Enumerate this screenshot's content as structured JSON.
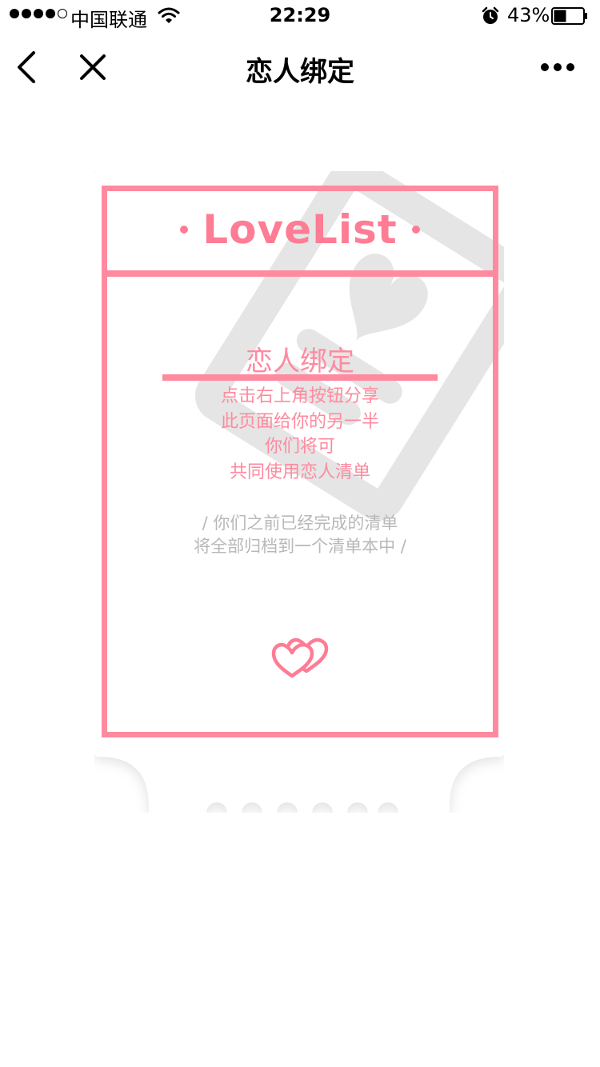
{
  "status_bar": {
    "carrier": "中国联通",
    "time": "22:29",
    "battery_percent": "43%",
    "battery_level": 0.43,
    "signal_bars_filled": 4,
    "signal_bars_total": 5
  },
  "nav": {
    "title": "恋人绑定"
  },
  "card": {
    "brand": "LoveList",
    "title": "恋人绑定",
    "description": [
      "点击右上角按钮分享",
      "此页面给你的另一半",
      "你们将可",
      "共同使用恋人清单"
    ],
    "note": [
      "/ 你们之前已经完成的清单",
      "将全部归档到一个清单本中 /"
    ]
  },
  "colors": {
    "accent_pink": "#fe8a9f",
    "note_gray": "#b8b8b8",
    "watermark_gray": "#e6e6e6"
  },
  "icons": [
    "back-arrow-icon",
    "close-icon",
    "more-icon",
    "wifi-icon",
    "alarm-icon",
    "battery-icon",
    "double-heart-icon",
    "list-heart-watermark-icon"
  ]
}
